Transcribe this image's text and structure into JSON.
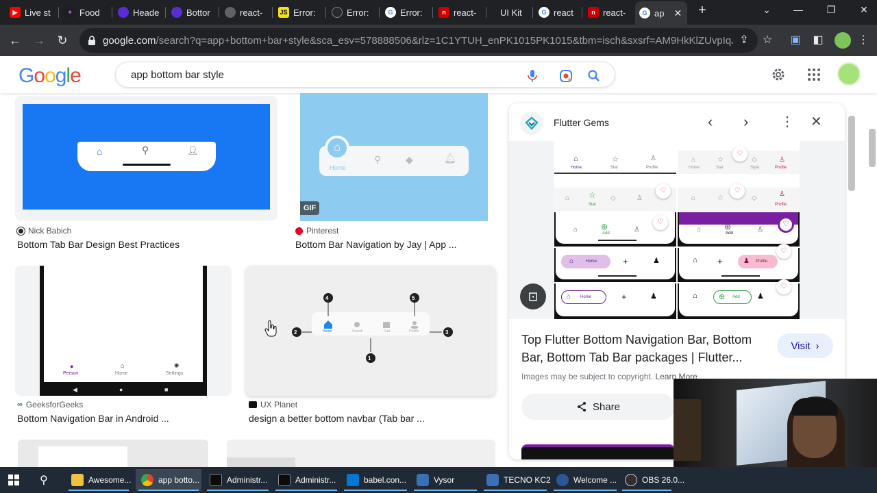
{
  "browser": {
    "tabs": [
      {
        "label": "Live st",
        "icon": "youtube-icon",
        "color": "#ff0000"
      },
      {
        "label": "Food",
        "icon": "figma-icon",
        "color": "#a259ff"
      },
      {
        "label": "Heade",
        "icon": "hex-icon",
        "color": "#5b2bd6"
      },
      {
        "label": "Bottor",
        "icon": "hex-icon",
        "color": "#5b2bd6"
      },
      {
        "label": "react-",
        "icon": "globe-icon",
        "color": "#5f6368"
      },
      {
        "label": "Error:",
        "icon": "js-icon",
        "color": "#f7df1e"
      },
      {
        "label": "Error:",
        "icon": "github-icon",
        "color": "#24292e"
      },
      {
        "label": "Error:",
        "icon": "google-icon",
        "color": "#ffffff"
      },
      {
        "label": "react-",
        "icon": "n-icon",
        "color": "#cc0000"
      },
      {
        "label": "UI Kit",
        "icon": "blank-icon",
        "color": "#202124"
      },
      {
        "label": "react",
        "icon": "google-icon",
        "color": "#ffffff"
      },
      {
        "label": "react-",
        "icon": "n-icon",
        "color": "#cc0000"
      },
      {
        "label": "ap",
        "icon": "google-icon",
        "color": "#ffffff"
      }
    ],
    "new_tab_glyph": "+",
    "url_host": "google.com",
    "url_rest": "/search?q=app+bottom+bar+style&sca_esv=578888506&rlz=1C1YTUH_enPK1015PK1015&tbm=isch&sxsrf=AM9HkKlZUvpIqJ..."
  },
  "google": {
    "logo_letters": [
      "G",
      "o",
      "o",
      "g",
      "l",
      "e"
    ],
    "logo_colors": [
      "#4285f4",
      "#ea4335",
      "#fbbc05",
      "#4285f4",
      "#34a853",
      "#ea4335"
    ],
    "query": "app bottom bar style"
  },
  "results": [
    {
      "source": "Nick Babich",
      "title": "Bottom Tab Bar Design Best Practices"
    },
    {
      "source": "Pinterest",
      "title": "Bottom Bar Navigation by Jay | App ...",
      "badge": "GIF"
    },
    {
      "source": "GeeksforGeeks",
      "title": "Bottom Navigation Bar in Android ..."
    },
    {
      "source": "UX Planet",
      "title": "design a better bottom navbar (Tab bar ..."
    }
  ],
  "thumb_labels": {
    "pinterest_home": "Home",
    "geeks_nav": [
      "Person",
      "Home",
      "Settings"
    ],
    "ux_nav": [
      "Home",
      "Search",
      "Cart",
      "Profile"
    ],
    "ux_callouts": [
      "4",
      "5",
      "2",
      "3",
      "1"
    ]
  },
  "panel": {
    "site": "Flutter Gems",
    "title": "Top Flutter Bottom Navigation Bar, Bottom Bar, Bottom Tab Bar packages | Flutter...",
    "visit_label": "Visit",
    "copyright": "Images may be subject to copyright.",
    "learn_more": "Learn More",
    "share_label": "Share",
    "preview_labels": [
      "Home",
      "Star",
      "Profile",
      "Home",
      "Star",
      "Style",
      "Profile",
      "Star",
      "Profile",
      "Add",
      "Add",
      "Home",
      "Profile",
      "Home",
      "Add"
    ]
  },
  "taskbar": [
    {
      "label": "Awesome...",
      "icon": "folder-icon",
      "color": "#f0c040"
    },
    {
      "label": "app botto...",
      "icon": "chrome-icon",
      "color": "#4285f4"
    },
    {
      "label": "Administr...",
      "icon": "terminal-icon",
      "color": "#0c0c0c"
    },
    {
      "label": "Administr...",
      "icon": "terminal-icon",
      "color": "#0c0c0c"
    },
    {
      "label": "babel.con...",
      "icon": "vscode-icon",
      "color": "#0078d4"
    },
    {
      "label": "Vysor",
      "icon": "vysor-icon",
      "color": "#3b6fb6"
    },
    {
      "label": "TECNO KC2",
      "icon": "vysor-icon",
      "color": "#3b6fb6"
    },
    {
      "label": "Welcome ...",
      "icon": "word-icon",
      "color": "#2b579a"
    },
    {
      "label": "OBS 26.0...",
      "icon": "obs-icon",
      "color": "#302e31"
    }
  ]
}
